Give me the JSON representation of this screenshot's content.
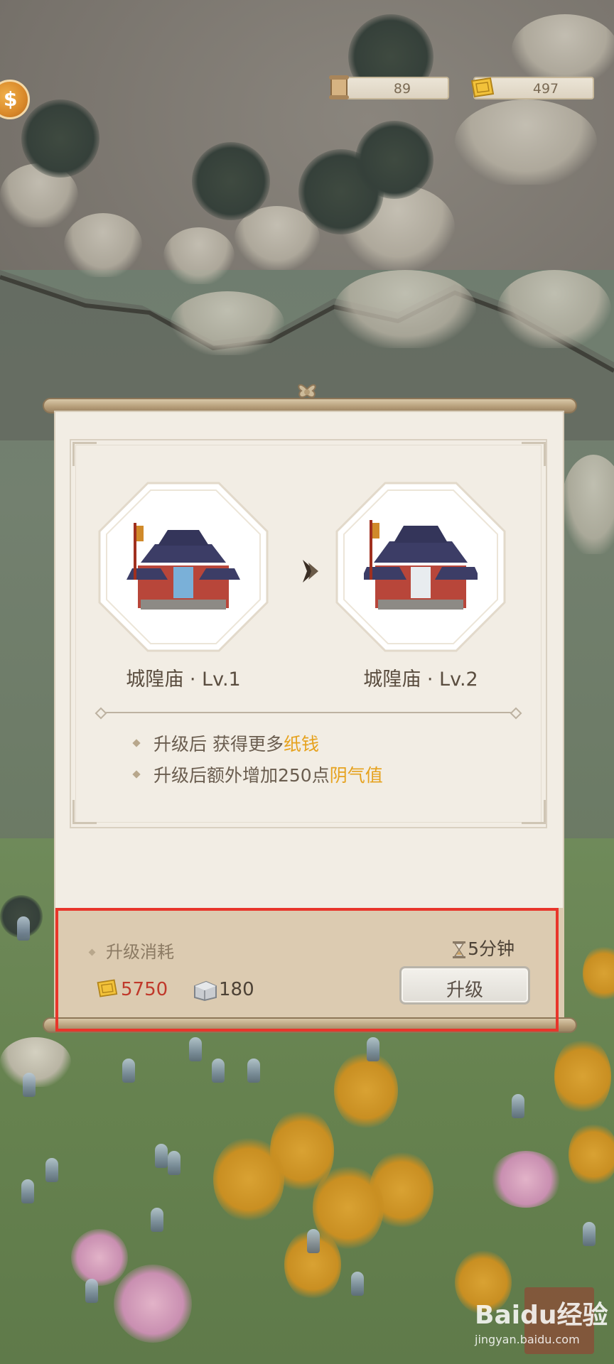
{
  "hud": {
    "scroll_count": "89",
    "paper_money": "497",
    "coin_button_glyph": "$",
    "scroll_icon": "scroll-icon",
    "paper_icon": "paper-money-icon"
  },
  "upgrade_panel": {
    "current": {
      "name": "城隍庙 · Lv.1"
    },
    "next": {
      "name": "城隍庙 · Lv.2"
    },
    "benefits": [
      {
        "prefix": "升级后 获得更多",
        "highlight": "纸钱"
      },
      {
        "prefix": "升级后额外增加250点",
        "highlight": "阴气值"
      }
    ],
    "cost": {
      "title": "升级消耗",
      "time": "5分钟",
      "paper_money": "5750",
      "stone": "180"
    },
    "upgrade_button": "升级"
  },
  "watermark": {
    "brand": "Baidu经验",
    "url": "jingyan.baidu.com"
  },
  "colors": {
    "highlight": "#e6a21e",
    "cost_red": "#c0392b",
    "annotation_red": "#e8352b",
    "panel_bg": "#f2ede4"
  }
}
